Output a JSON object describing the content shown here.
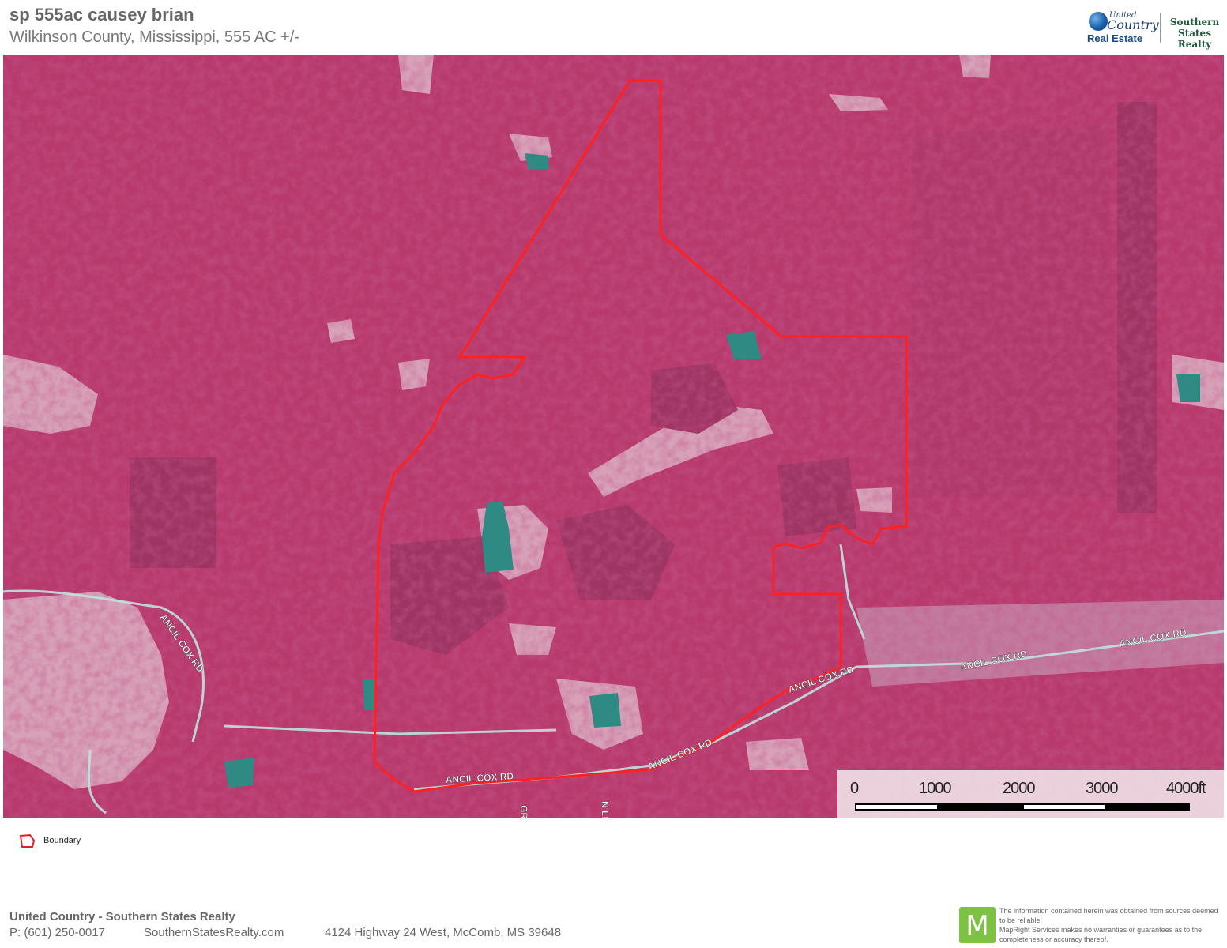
{
  "header": {
    "title": "sp 555ac causey brian",
    "subtitle": "Wilkinson County, Mississippi, 555 AC +/-"
  },
  "logo": {
    "united": "United",
    "country": "Country",
    "real_estate": "Real Estate",
    "southern": "Southern",
    "states_realty": "States Realty"
  },
  "map": {
    "road_labels": [
      "ANCIL COX RD",
      "ANCIL COX RD",
      "ANCIL COX RD",
      "ANCIL COX RD",
      "ANCIL COX RD",
      "ANCIL COX RD",
      "GR",
      "N LN"
    ],
    "boundary_color": "#ff2020",
    "imagery_colors": {
      "forest": "#b83a6c",
      "clearing": "#d9a3b9",
      "water": "#2f8f86"
    }
  },
  "scale": {
    "labels": [
      "0",
      "1000",
      "2000",
      "3000",
      "4000ft"
    ]
  },
  "legend": {
    "label": "Boundary",
    "icon": "boundary-polygon-icon"
  },
  "footer": {
    "company": "United Country - Southern States Realty",
    "phone": "P: (601) 250-0017",
    "website": "SouthernStatesRealty.com",
    "address": "4124 Highway 24 West, McComb, MS 39648"
  },
  "disclaimer": {
    "line1": "The information contained herein was obtained from sources deemed to be reliable.",
    "line2": "MapRight Services makes no warranties or guarantees as to the completeness or accuracy thereof.",
    "logo_letter": "M"
  }
}
